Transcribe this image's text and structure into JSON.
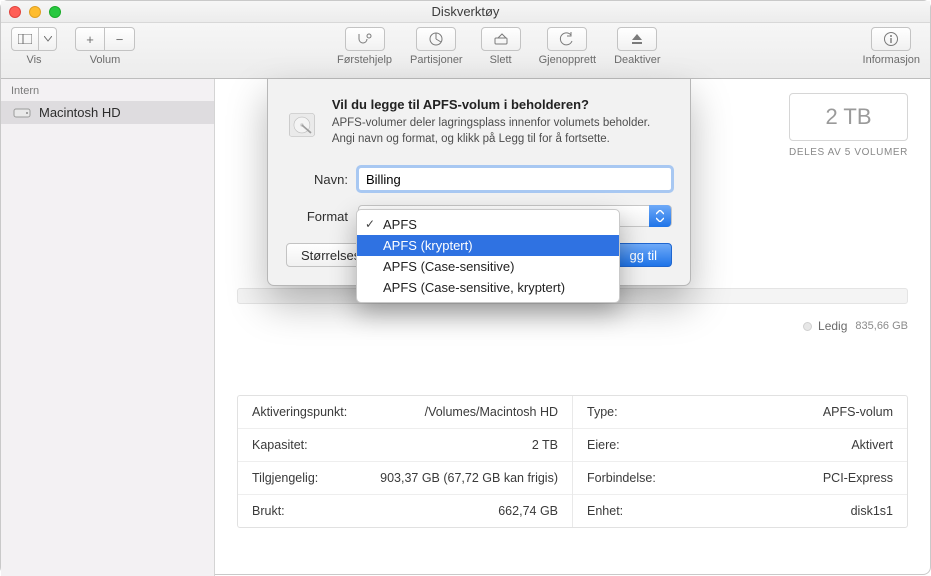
{
  "window": {
    "title": "Diskverktøy"
  },
  "toolbar": {
    "view": "Vis",
    "volume": "Volum",
    "first_aid": "Førstehjelp",
    "partition": "Partisjoner",
    "erase": "Slett",
    "restore": "Gjenoprett",
    "restore_actual": "Gjenopprett",
    "unmount": "Deaktiver",
    "info": "Informasjon"
  },
  "sidebar": {
    "section": "Intern",
    "items": [
      {
        "label": "Macintosh HD"
      }
    ]
  },
  "capacity": {
    "value": "2 TB",
    "subtitle": "DELES AV 5 VOLUMER"
  },
  "legend": {
    "free_label": "Ledig",
    "free_value": "835,66 GB"
  },
  "info_left": [
    {
      "k": "Aktiveringspunkt:",
      "v": "/Volumes/Macintosh HD"
    },
    {
      "k": "Kapasitet:",
      "v": "2 TB"
    },
    {
      "k": "Tilgjengelig:",
      "v": "903,37 GB (67,72 GB kan frigis)"
    },
    {
      "k": "Brukt:",
      "v": "662,74 GB"
    }
  ],
  "info_right": [
    {
      "k": "Type:",
      "v": "APFS-volum"
    },
    {
      "k": "Eiere:",
      "v": "Aktivert"
    },
    {
      "k": "Forbindelse:",
      "v": "PCI-Express"
    },
    {
      "k": "Enhet:",
      "v": "disk1s1"
    }
  ],
  "sheet": {
    "title": "Vil du legge til APFS-volum i beholderen?",
    "desc": "APFS-volumer deler lagringsplass innenfor volumets beholder. Angi navn og format, og klikk på Legg til for å fortsette.",
    "name_label": "Navn:",
    "name_value": "Billing",
    "format_label": "Format",
    "size_button": "Størrelsesv",
    "add_button": "gg til"
  },
  "dropdown": {
    "options": [
      "APFS",
      "APFS (kryptert)",
      "APFS (Case-sensitive)",
      "APFS (Case-sensitive, kryptert)"
    ],
    "checked_index": 0,
    "highlight_index": 1
  }
}
